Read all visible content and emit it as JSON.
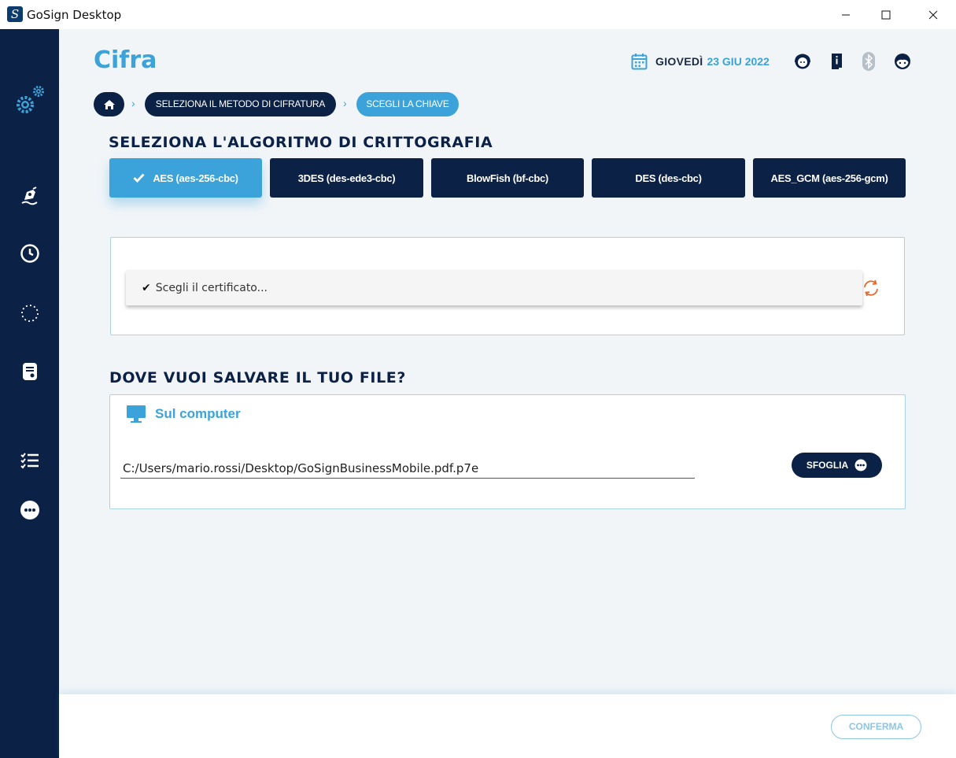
{
  "window": {
    "title": "GoSign Desktop",
    "logo_letter": "S"
  },
  "header": {
    "page_title": "Cifra",
    "date_day": "GIOVEDÌ",
    "date_value": "23 GIU 2022"
  },
  "breadcrumb": {
    "step1": "SELEZIONA IL METODO DI CIFRATURA",
    "step2": "SCEGLI LA CHIAVE"
  },
  "algorithm_section": {
    "title": "SELEZIONA L'ALGORITMO DI CRITTOGRAFIA",
    "options": [
      {
        "label": "AES (aes-256-cbc)",
        "selected": true
      },
      {
        "label": "3DES (des-ede3-cbc)",
        "selected": false
      },
      {
        "label": "BlowFish (bf-cbc)",
        "selected": false
      },
      {
        "label": "DES (des-cbc)",
        "selected": false
      },
      {
        "label": "AES_GCM (aes-256-gcm)",
        "selected": false
      }
    ]
  },
  "certificate": {
    "placeholder": "Scegli il certificato..."
  },
  "save_section": {
    "title": "DOVE VUOI SALVARE IL TUO FILE?",
    "location_label": "Sul computer",
    "path": "C:/Users/mario.rossi/Desktop/GoSignBusinessMobile.pdf.p7e",
    "browse_label": "SFOGLIA"
  },
  "footer": {
    "confirm_label": "CONFERMA"
  },
  "colors": {
    "navy": "#0b2146",
    "accent": "#3ba3d9",
    "background": "#f1f5f8",
    "refresh": "#e8692b"
  },
  "icons": {
    "sidebar": [
      "settings-gears-icon",
      "sign-pen-icon",
      "history-clock-icon",
      "loading-circle-icon",
      "document-icon",
      "checklist-icon",
      "more-dots-icon"
    ],
    "header": [
      "calendar-icon",
      "support-agent-icon",
      "info-book-icon",
      "bluetooth-icon",
      "user-face-icon"
    ]
  }
}
